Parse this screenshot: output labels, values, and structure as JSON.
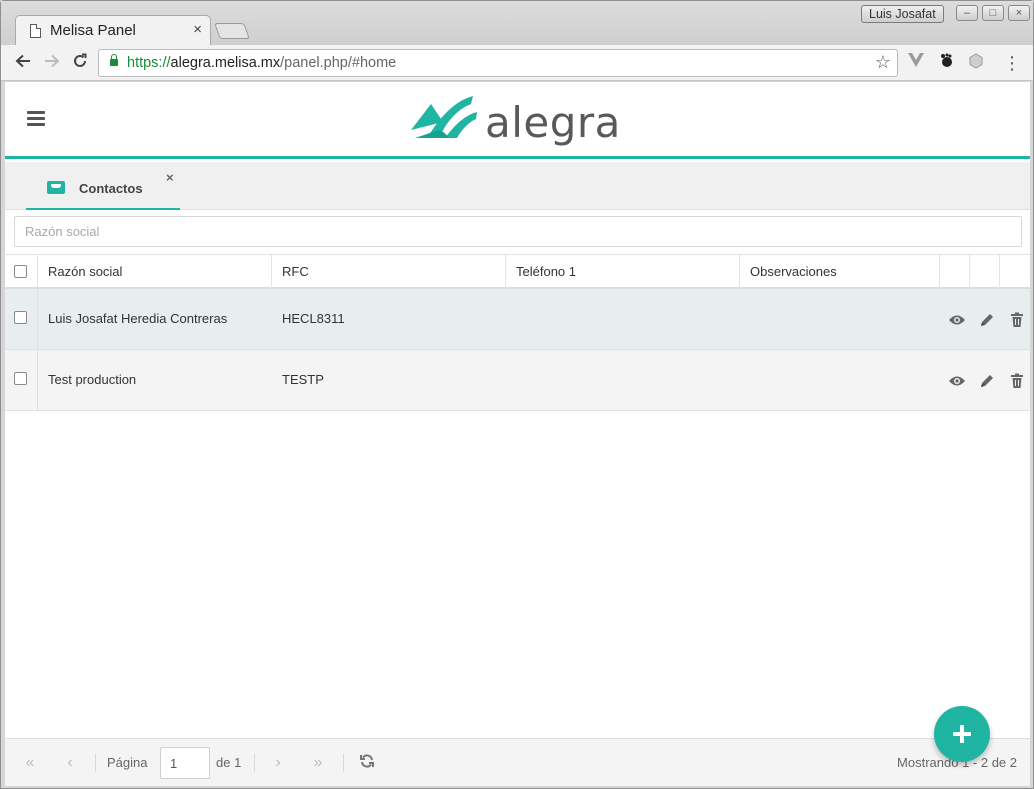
{
  "browser": {
    "tab_title": "Melisa Panel",
    "tab_close": "×",
    "profile_name": "Luis Josafat",
    "url_scheme": "https://",
    "url_host": "alegra.melisa.mx",
    "url_path": "/panel.php/#home"
  },
  "header": {
    "logo_text": "alegra",
    "accent_color": "#20b5a2"
  },
  "tabs": [
    {
      "label": "Contactos",
      "icon": "inbox-icon",
      "close": "×"
    }
  ],
  "search": {
    "placeholder": "Razón social",
    "value": ""
  },
  "table": {
    "columns": [
      "Razón social",
      "RFC",
      "Teléfono 1",
      "Observaciones"
    ],
    "rows": [
      {
        "razon_social": "Luis Josafat Heredia Contreras",
        "rfc": "HECL8311",
        "telefono": "",
        "observaciones": ""
      },
      {
        "razon_social": "Test production",
        "rfc": "TESTP",
        "telefono": "",
        "observaciones": ""
      }
    ],
    "row_actions": [
      "view-icon",
      "edit-icon",
      "delete-icon"
    ]
  },
  "pagination": {
    "page_label": "Página",
    "page_value": "1",
    "of_label": "de 1",
    "showing": "Mostrando 1 - 2 de 2"
  },
  "fab": {
    "icon": "plus-icon"
  }
}
